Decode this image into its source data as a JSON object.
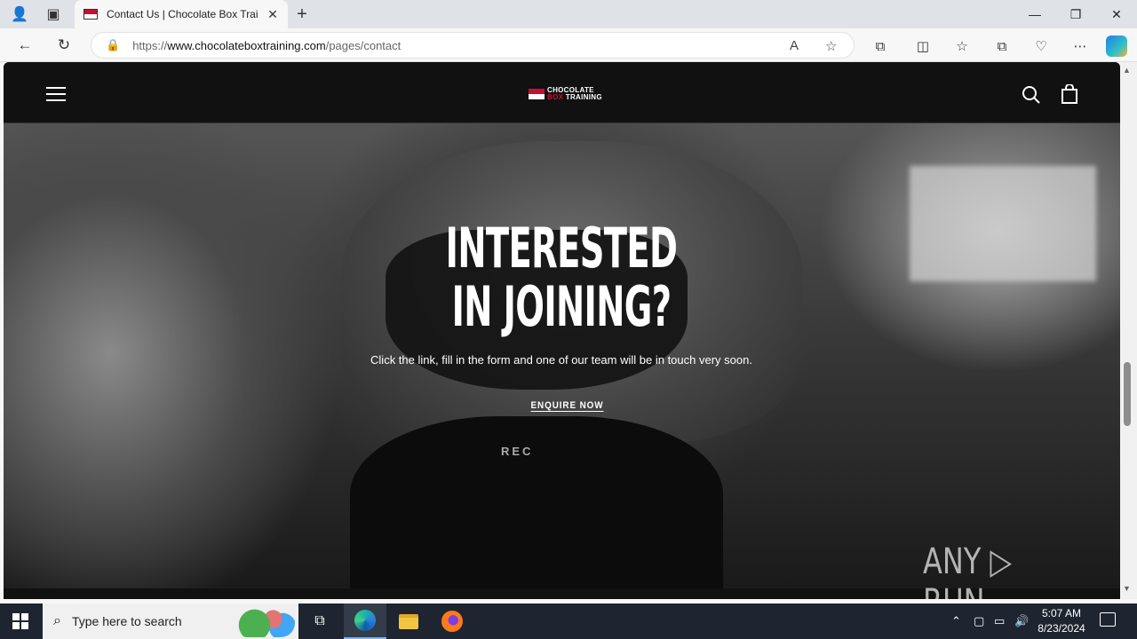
{
  "browser": {
    "tab_title": "Contact Us | Chocolate Box Trainin",
    "tab_close": "✕",
    "new_tab": "+",
    "url_prefix": "https://",
    "url_domain": "www.chocolateboxtraining.com",
    "url_path": "/pages/contact",
    "window_controls": {
      "minimize": "—",
      "restore": "❐",
      "close": "✕"
    }
  },
  "site": {
    "logo_line1": "CHOCOLATE",
    "logo_line2_box": "BOX",
    "logo_line2_training": "TRAINING",
    "hero": {
      "title": "INTERESTED IN JOINING?",
      "subtitle": "Click the link, fill in the form and one of our team will be in touch very soon.",
      "cta": "ENQUIRE NOW",
      "shorts_text": "REC"
    }
  },
  "watermark": "ANY ▷ RUN",
  "taskbar": {
    "search_placeholder": "Type here to search",
    "time": "5:07 AM",
    "date": "8/23/2024"
  }
}
